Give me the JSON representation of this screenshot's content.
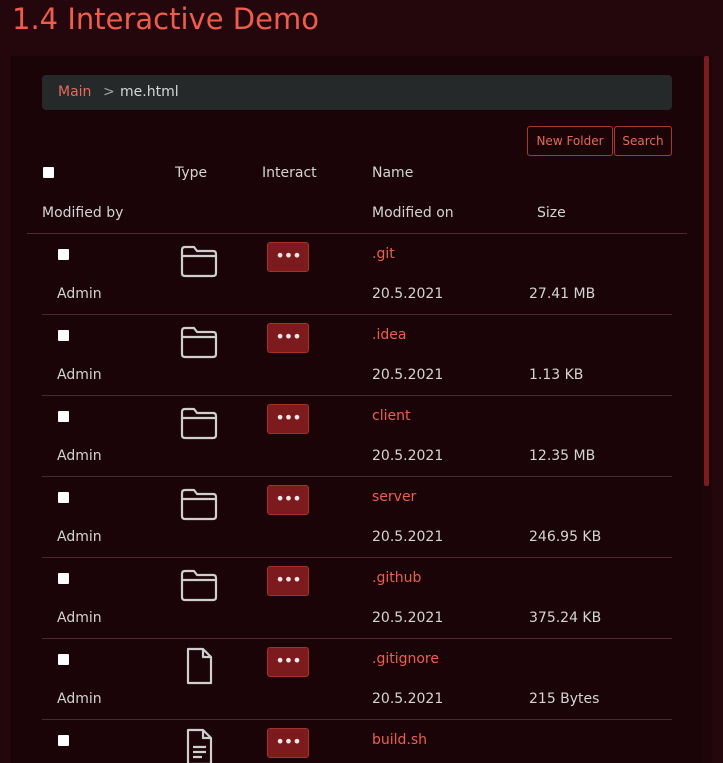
{
  "page_title": "1.4 Interactive Demo",
  "breadcrumb": {
    "root": "Main",
    "separator": ">",
    "current": "me.html"
  },
  "toolbar": {
    "new_folder_label": "New Folder",
    "search_label": "Search"
  },
  "table": {
    "headers": {
      "type": "Type",
      "interact": "Interact",
      "name": "Name",
      "modified_by": "Modified by",
      "modified_on": "Modified on",
      "size": "Size"
    },
    "rows": [
      {
        "name": ".git",
        "icon": "folder-icon",
        "interact": "•••",
        "modified_by": "Admin",
        "modified_on": "20.5.2021",
        "size": "27.41 MB"
      },
      {
        "name": ".idea",
        "icon": "folder-icon",
        "interact": "•••",
        "modified_by": "Admin",
        "modified_on": "20.5.2021",
        "size": "1.13 KB"
      },
      {
        "name": "client",
        "icon": "folder-icon",
        "interact": "•••",
        "modified_by": "Admin",
        "modified_on": "20.5.2021",
        "size": "12.35 MB"
      },
      {
        "name": "server",
        "icon": "folder-icon",
        "interact": "•••",
        "modified_by": "Admin",
        "modified_on": "20.5.2021",
        "size": "246.95 KB"
      },
      {
        "name": ".github",
        "icon": "folder-icon",
        "interact": "•••",
        "modified_by": "Admin",
        "modified_on": "20.5.2021",
        "size": "375.24 KB"
      },
      {
        "name": ".gitignore",
        "icon": "file-icon",
        "interact": "•••",
        "modified_by": "Admin",
        "modified_on": "20.5.2021",
        "size": "215 Bytes"
      },
      {
        "name": "build.sh",
        "icon": "text-file-icon",
        "interact": "•••",
        "modified_by": "",
        "modified_on": "",
        "size": ""
      }
    ]
  },
  "colors": {
    "accent": "#ee5d4c",
    "background": "#24060d",
    "panel": "#1a0408",
    "button_fill": "#7d1a1d"
  }
}
